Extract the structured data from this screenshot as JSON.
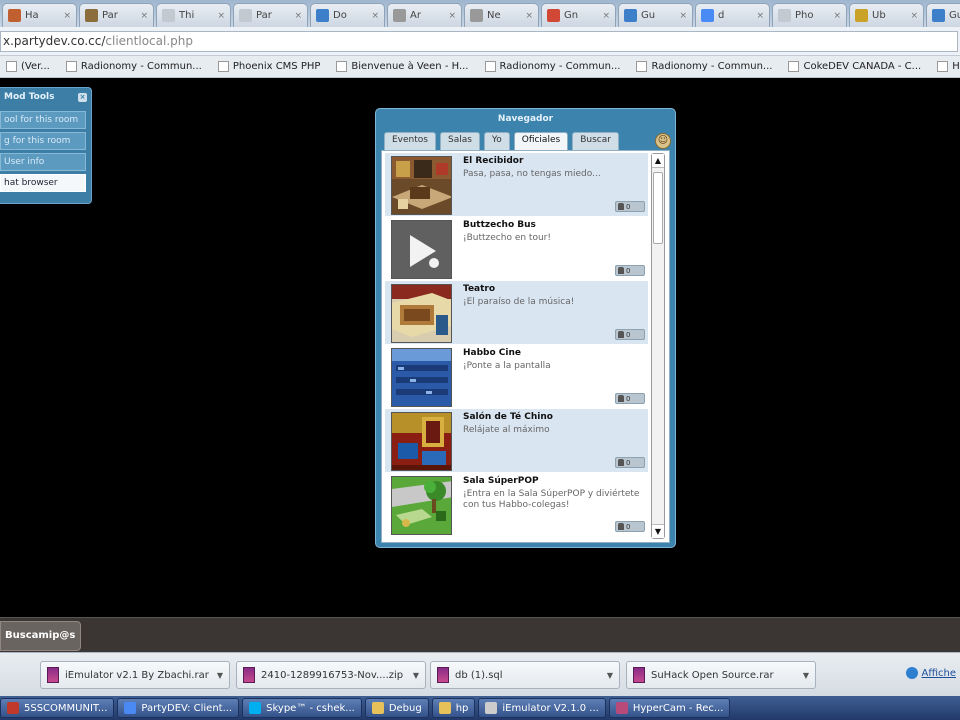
{
  "browser": {
    "tabs": [
      {
        "label": "Ha",
        "icon": "web-page-icon",
        "color": "#c06030"
      },
      {
        "label": "Par",
        "icon": "habbo-icon",
        "color": "#8a6d3b"
      },
      {
        "label": "Thi",
        "icon": "web-page-icon",
        "color": "#c2c9d1"
      },
      {
        "label": "Par",
        "icon": "web-page-icon",
        "color": "#c2c9d1"
      },
      {
        "label": "Do",
        "icon": "globe-icon",
        "color": "#3d7fc9"
      },
      {
        "label": "Ar",
        "icon": "clock-icon",
        "color": "#999999"
      },
      {
        "label": "Ne",
        "icon": "clock-icon",
        "color": "#999999"
      },
      {
        "label": "Gn",
        "icon": "gmail-icon",
        "color": "#d14836"
      },
      {
        "label": "Gu",
        "icon": "globe-icon",
        "color": "#3d7fc9"
      },
      {
        "label": "d",
        "icon": "google-icon",
        "color": "#4a8af4"
      },
      {
        "label": "Pho",
        "icon": "web-page-icon",
        "color": "#c2c9d1"
      },
      {
        "label": "Ub",
        "icon": "trophy-icon",
        "color": "#c9a227"
      },
      {
        "label": "Gu",
        "icon": "globe-icon",
        "color": "#3d7fc9"
      }
    ],
    "url_prefix": "x.partydev.co.cc/",
    "url_path": "clientlocal.php",
    "bookmarks": [
      "(Ver...",
      "Radionomy - Commun...",
      "Phoenix CMS PHP",
      "Bienvenue à Veen - H...",
      "Radionomy - Commun...",
      "Radionomy - Commun...",
      "CokeDEV CANADA - C...",
      "HabbShoot >> Té"
    ]
  },
  "mod_tools": {
    "title": "Mod Tools",
    "buttons": [
      {
        "label": "ool for this room",
        "active": false
      },
      {
        "label": "g for this room",
        "active": false
      },
      {
        "label": "User info",
        "active": false
      },
      {
        "label": "hat browser",
        "active": true
      }
    ]
  },
  "navigator": {
    "title": "Navegador",
    "tabs": [
      {
        "label": "Eventos",
        "active": false
      },
      {
        "label": "Salas",
        "active": false
      },
      {
        "label": "Yo",
        "active": false
      },
      {
        "label": "Oficiales",
        "active": true
      },
      {
        "label": "Buscar",
        "active": false
      }
    ],
    "rooms": [
      {
        "name": "El Recibidor",
        "desc": "Pasa, pasa, no tengas miedo...",
        "count": "0",
        "thumb": "lobby"
      },
      {
        "name": "Buttzecho Bus",
        "desc": "¡Buttzecho en tour!",
        "count": "0",
        "thumb": "video"
      },
      {
        "name": "Teatro",
        "desc": "¡El paraíso de la música!",
        "count": "0",
        "thumb": "theatre"
      },
      {
        "name": "Habbo Cine",
        "desc": "¡Ponte a la pantalla",
        "count": "0",
        "thumb": "cinema"
      },
      {
        "name": "Salón de Té Chino",
        "desc": "Relájate al máximo",
        "count": "0",
        "thumb": "tea"
      },
      {
        "name": "Sala SúperPOP",
        "desc": "¡Entra en la Sala SúperPOP y diviértete con tus Habbo-colegas!",
        "count": "0",
        "thumb": "park"
      }
    ]
  },
  "hotel_toolbar": {
    "button_label": "Buscamip@s"
  },
  "downloads": {
    "items": [
      "iEmulator v2.1 By Zbachi.rar",
      "2410-1289916753-Nov....zip",
      "db (1).sql",
      "SuHack Open Source.rar"
    ],
    "show_all": "Affiche"
  },
  "taskbar": {
    "items": [
      {
        "label": "5SSCOMMUNIT...",
        "color": "#c0392b"
      },
      {
        "label": "PartyDEV: Client...",
        "color": "#4a8af4"
      },
      {
        "label": "Skype™ - cshek...",
        "color": "#00aff0"
      },
      {
        "label": "Debug",
        "color": "#e6c15a"
      },
      {
        "label": "hp",
        "color": "#e6c15a"
      },
      {
        "label": "iEmulator V2.1.0 ...",
        "color": "#cccccc"
      },
      {
        "label": "HyperCam - Rec...",
        "color": "#b84a7a"
      }
    ]
  }
}
